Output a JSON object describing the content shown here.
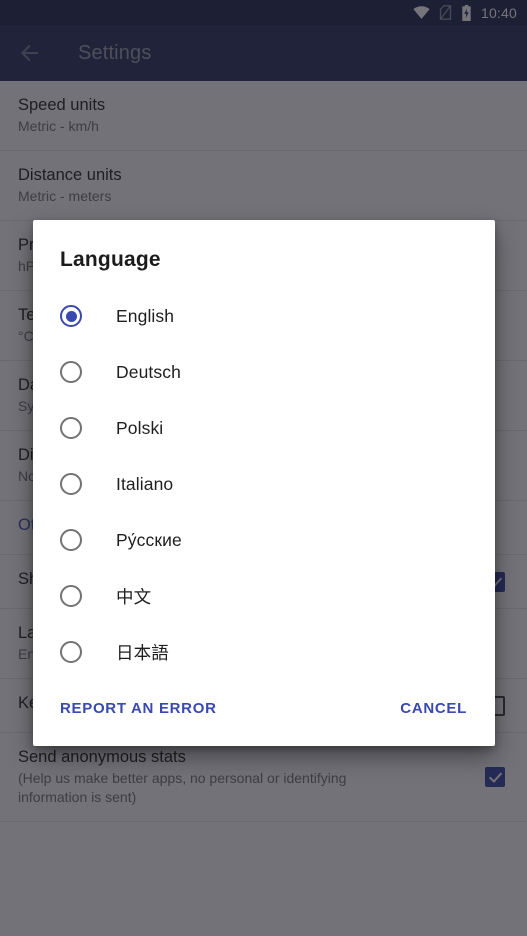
{
  "status_bar": {
    "time": "10:40",
    "icons": [
      "wifi-icon",
      "sim-missing-icon",
      "battery-charging-icon"
    ]
  },
  "app_bar": {
    "back_icon": "back-arrow-icon",
    "title": "Settings"
  },
  "settings_rows": [
    {
      "title": "Speed units",
      "subtitle": "Metric - km/h",
      "control": "none"
    },
    {
      "title": "Distance units",
      "subtitle": "Metric - meters",
      "control": "none"
    },
    {
      "title": "Pressure units",
      "subtitle": "hPa",
      "control": "none"
    },
    {
      "title": "Temperature units",
      "subtitle": "°C",
      "control": "none"
    },
    {
      "title": "Date format",
      "subtitle": "System default",
      "control": "none"
    },
    {
      "title": "Distance format",
      "subtitle": "Normal",
      "control": "none"
    },
    {
      "title": "Other settings",
      "subtitle": "",
      "control": "none",
      "link": true
    },
    {
      "title": "Show speed",
      "subtitle": "",
      "control": "checkbox",
      "checked": true
    },
    {
      "title": "Language",
      "subtitle": "English",
      "control": "none"
    },
    {
      "title": "Keep screen on",
      "subtitle": "",
      "control": "checkbox",
      "checked": false
    },
    {
      "title": "Send anonymous stats",
      "subtitle": "(Help us make better apps, no personal or identifying information is sent)",
      "control": "checkbox",
      "checked": true
    }
  ],
  "dialog": {
    "title": "Language",
    "selected": "English",
    "options": [
      {
        "label": "English",
        "selected": true
      },
      {
        "label": "Deutsch",
        "selected": false
      },
      {
        "label": "Polski",
        "selected": false
      },
      {
        "label": "Italiano",
        "selected": false
      },
      {
        "label": "Ру́сские",
        "selected": false
      },
      {
        "label": "中文",
        "selected": false
      },
      {
        "label": "日本語",
        "selected": false
      }
    ],
    "report_label": "REPORT AN ERROR",
    "cancel_label": "CANCEL"
  },
  "colors": {
    "status_bar": "#1b2047",
    "app_bar": "#242b54",
    "accent": "#3949b0",
    "scrim": "rgba(30,30,40,0.62)"
  }
}
